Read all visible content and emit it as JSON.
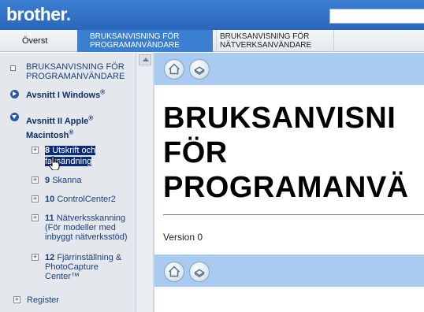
{
  "header": {
    "logo": "brother",
    "logo_dot": "."
  },
  "tabs": [
    {
      "label": "Överst"
    },
    {
      "label_line1": "BRUKSANVISNING FÖR",
      "label_line2": "PROGRAMANVÄNDARE",
      "active": true
    },
    {
      "label_line1": "BRUKSANVISNING FÖR",
      "label_line2": "NÄTVERKSANVÄNDARE"
    }
  ],
  "sidebar": {
    "item_top_line1": "BRUKSANVISNING FÖR",
    "item_top_line2": "PROGRAMANVÄNDARE",
    "section_windows": "Avsnitt I Windows",
    "section_windows_sup": "®",
    "section_mac_line1": "Avsnitt II Apple",
    "section_mac_sup1": "®",
    "section_mac_line2": "Macintosh",
    "section_mac_sup2": "®",
    "items": [
      {
        "num": "8",
        "label_line1": "Utskrift och",
        "label_line2": "faxsändning"
      },
      {
        "num": "9",
        "label": "Skanna"
      },
      {
        "num": "10",
        "label": "ControlCenter2"
      },
      {
        "num": "11",
        "label_line1": "Nätverksskanning",
        "label_line2": "(För modeller med",
        "label_line3": "inbyggt nätverksstöd)"
      },
      {
        "num": "12",
        "label_line1": "Fjärrinställning &",
        "label_line2": "PhotoCapture",
        "label_line3": "Center™"
      }
    ],
    "register": "Register"
  },
  "main": {
    "title_line1": "BRUKSANVISNI",
    "title_line2": "FÖR",
    "title_line3": "PROGRAMANVÄ",
    "version": "Version 0"
  },
  "colors": {
    "header_blue": "#3b7fd1",
    "band_blue": "#a8cbef",
    "sidebar_bg": "#e4e8ec",
    "link": "#1c3f7a",
    "highlight": "#0a2a7a"
  }
}
